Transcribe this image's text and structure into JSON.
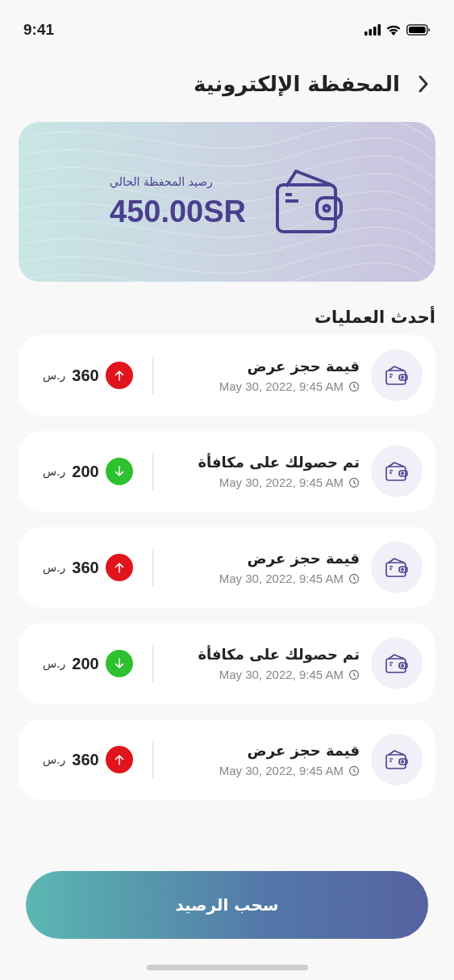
{
  "status_bar": {
    "time": "9:41"
  },
  "header": {
    "title": "المحفظة الإلكترونية"
  },
  "balance_card": {
    "label": "رصيد المحفظة الحالي",
    "amount": "450.00SR"
  },
  "section_title": "أحدث العمليات",
  "transactions": [
    {
      "title": "قيمة حجز عرض",
      "date": "May 30, 2022, 9:45 AM",
      "kind": "debit",
      "amount": "360",
      "currency": "ر.س"
    },
    {
      "title": "تم حصولك على مكافأة",
      "date": "May 30, 2022, 9:45 AM",
      "kind": "credit",
      "amount": "200",
      "currency": "ر.س"
    },
    {
      "title": "قيمة حجز عرض",
      "date": "May 30, 2022, 9:45 AM",
      "kind": "debit",
      "amount": "360",
      "currency": "ر.س"
    },
    {
      "title": "تم حصولك على مكافأة",
      "date": "May 30, 2022, 9:45 AM",
      "kind": "credit",
      "amount": "200",
      "currency": "ر.س"
    },
    {
      "title": "قيمة حجز عرض",
      "date": "May 30, 2022, 9:45 AM",
      "kind": "debit",
      "amount": "360",
      "currency": "ر.س"
    }
  ],
  "withdraw_button": "سحب الرصيد"
}
